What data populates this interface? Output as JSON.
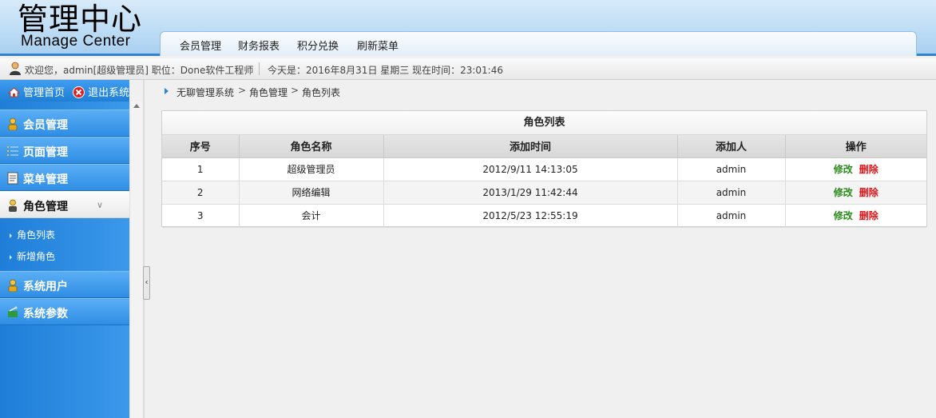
{
  "header": {
    "logo_cn": "管理中心",
    "logo_en": "Manage Center",
    "nav": [
      "会员管理",
      "财务报表",
      "积分兑换",
      "刷新菜单"
    ]
  },
  "status": {
    "welcome": "欢迎您，admin[超级管理员] 职位：Done软件工程师",
    "today": "今天是：2016年8月31日   星期三   现在时间：23:01:46"
  },
  "sidebar": {
    "home_label": "管理首页",
    "logout_label": "退出系统",
    "menus": [
      {
        "label": "会员管理",
        "icon": "user-icon"
      },
      {
        "label": "页面管理",
        "icon": "list-icon"
      },
      {
        "label": "菜单管理",
        "icon": "document-icon"
      },
      {
        "label": "角色管理",
        "icon": "role-icon"
      },
      {
        "label": "系统用户",
        "icon": "user-icon"
      },
      {
        "label": "系统参数",
        "icon": "settings-icon"
      }
    ],
    "submenu": [
      "角色列表",
      "新增角色"
    ]
  },
  "breadcrumb": [
    "无聊管理系统",
    "角色管理",
    "角色列表"
  ],
  "table": {
    "title": "角色列表",
    "columns": [
      "序号",
      "角色名称",
      "添加时间",
      "添加人",
      "操作"
    ],
    "rows": [
      {
        "no": "1",
        "name": "超级管理员",
        "time": "2012/9/11 14:13:05",
        "by": "admin"
      },
      {
        "no": "2",
        "name": "网络编辑",
        "time": "2013/1/29 11:42:44",
        "by": "admin"
      },
      {
        "no": "3",
        "name": "会计",
        "time": "2012/5/23 12:55:19",
        "by": "admin"
      }
    ],
    "edit_label": "修改",
    "delete_label": "删除"
  },
  "colors": {
    "accent": "#2f83cf",
    "edit": "#2a8a1a",
    "delete": "#e0161b"
  }
}
